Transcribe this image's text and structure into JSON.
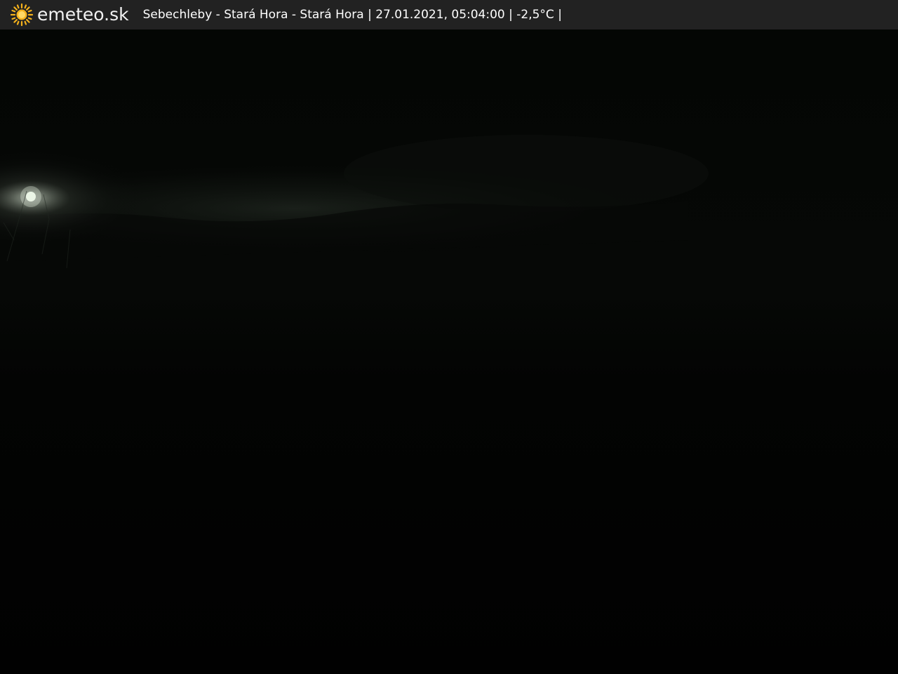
{
  "header": {
    "brand": "emeteo.sk",
    "logo_icon": "sun-icon",
    "caption": "Sebechleby - Stará Hora - Stará Hora | 27.01.2021, 05:04:00 | -2,5°C |",
    "brand_color": "#f2f2f2",
    "bar_color": "#222222",
    "sun_color": "#f5b21c"
  },
  "scene": {
    "subject": "night webcam view over dark landscape with moon low on horizon",
    "sky_color": "#020302",
    "moon_color": "#eaf5e6"
  }
}
